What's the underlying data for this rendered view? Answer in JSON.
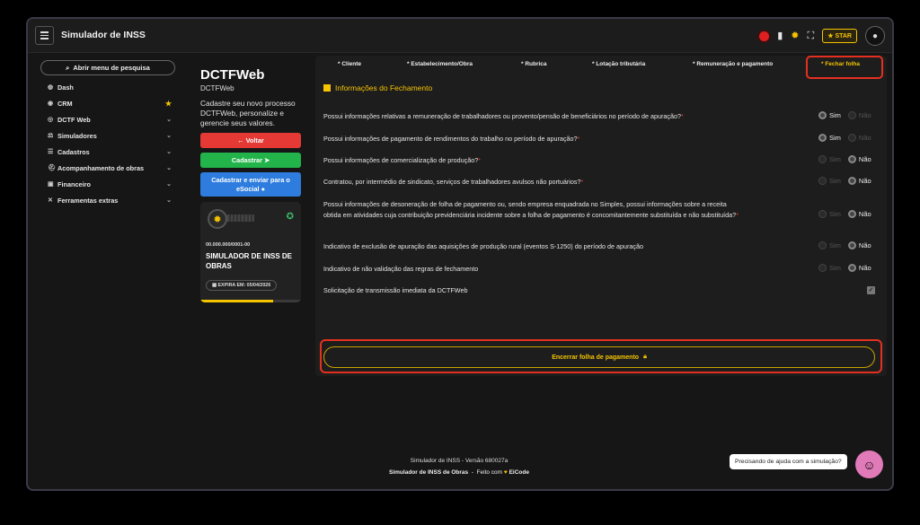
{
  "header": {
    "app_title": "Simulador de INSS",
    "star_label": "STAR",
    "icons": [
      "menu-icon",
      "record-icon",
      "file-icon",
      "sun-icon",
      "expand-icon",
      "star-icon",
      "user-icon"
    ]
  },
  "sidebar": {
    "search_label": "Abrir menu de pesquisa",
    "items": [
      {
        "label": "Dash",
        "icon": "dashboard-icon"
      },
      {
        "label": "CRM",
        "icon": "crm-icon"
      },
      {
        "label": "DCTF Web",
        "icon": "globe-icon"
      },
      {
        "label": "Simuladores",
        "icon": "simulators-icon"
      },
      {
        "label": "Cadastros",
        "icon": "list-icon"
      },
      {
        "label": "Acompanhamento de obras",
        "icon": "construction-icon"
      },
      {
        "label": "Financeiro",
        "icon": "money-icon"
      },
      {
        "label": "Ferramentas extras",
        "icon": "tools-icon"
      }
    ]
  },
  "left_panel": {
    "title": "DCTFWeb",
    "subtitle": "DCTFWeb",
    "description": "Cadastre seu novo processo DCTFWeb, personalize e gerencie seus valores.",
    "back_label": "← Voltar",
    "register_label": "Cadastrar",
    "register_send_label": "Cadastrar e enviar para o eSocial",
    "card": {
      "cnpj": "00.000.000/0001-00",
      "title": "SIMULADOR DE INSS DE OBRAS",
      "expira": "EXPIRA EM: 05/04/2026",
      "progress": 0.72
    }
  },
  "tabs": [
    {
      "label": "* Cliente",
      "active": false
    },
    {
      "label": "* Estabelecimento/Obra",
      "active": false
    },
    {
      "label": "* Rubrica",
      "active": false
    },
    {
      "label": "* Lotação tributária",
      "active": false
    },
    {
      "label": "* Remuneração e pagamento",
      "active": false
    },
    {
      "label": "* Fechar folha",
      "active": true
    }
  ],
  "section_title": "Informações do Fechamento",
  "questions": [
    {
      "text": "Possui informações relativas a remuneração de trabalhadores ou provento/pensão de beneficiários no período de apuração?",
      "required": "*",
      "yes": "Sim",
      "no": "Não",
      "selected": "yes"
    },
    {
      "text": "Possui informações de pagamento de rendimentos do trabalho no período de apuração?",
      "required": "*",
      "yes": "Sim",
      "no": "Não",
      "selected": "yes"
    },
    {
      "text": "Possui informações de comercialização de produção?",
      "required": "*",
      "yes": "Sim",
      "no": "Não",
      "selected": "no"
    },
    {
      "text": "Contratou, por intermédio de sindicato, serviços de trabalhadores avulsos não portuários?",
      "required": "*",
      "yes": "Sim",
      "no": "Não",
      "selected": "no"
    },
    {
      "text": "Possui informações de desoneração de folha de pagamento ou, sendo empresa enquadrada no Simples, possui informações sobre a receita obtida em atividades cuja contribuição previdenciária incidente sobre a folha de pagamento é concomitantemente substituída e não substituída?",
      "required": "*",
      "yes": "Sim",
      "no": "Não",
      "selected": "no"
    },
    {
      "text": "Indicativo de exclusão de apuração das aquisições de produção rural (eventos S-1250) do período de apuração",
      "required": "",
      "yes": "Sim",
      "no": "Não",
      "selected": "no"
    },
    {
      "text": "Indicativo de não validação das regras de fechamento",
      "required": "",
      "yes": "Sim",
      "no": "Não",
      "selected": "no"
    }
  ],
  "transmission_label": "Solicitação de transmissão imediata da DCTFWeb",
  "transmission_checked": true,
  "close_button_label": "Encerrar folha de pagamento",
  "footer": {
    "version": "Simulador de INSS - Versão 680027a",
    "product": "Simulador de INSS de Obras",
    "made_by_prefix": "Feito com",
    "made_by": "EiCode"
  },
  "help_text": "Precisando de ajuda com a simulação?",
  "colors": {
    "accent": "#f5c400",
    "danger": "#e53935",
    "success": "#22b34a",
    "primary": "#2e7dde",
    "highlight": "#e53020"
  }
}
